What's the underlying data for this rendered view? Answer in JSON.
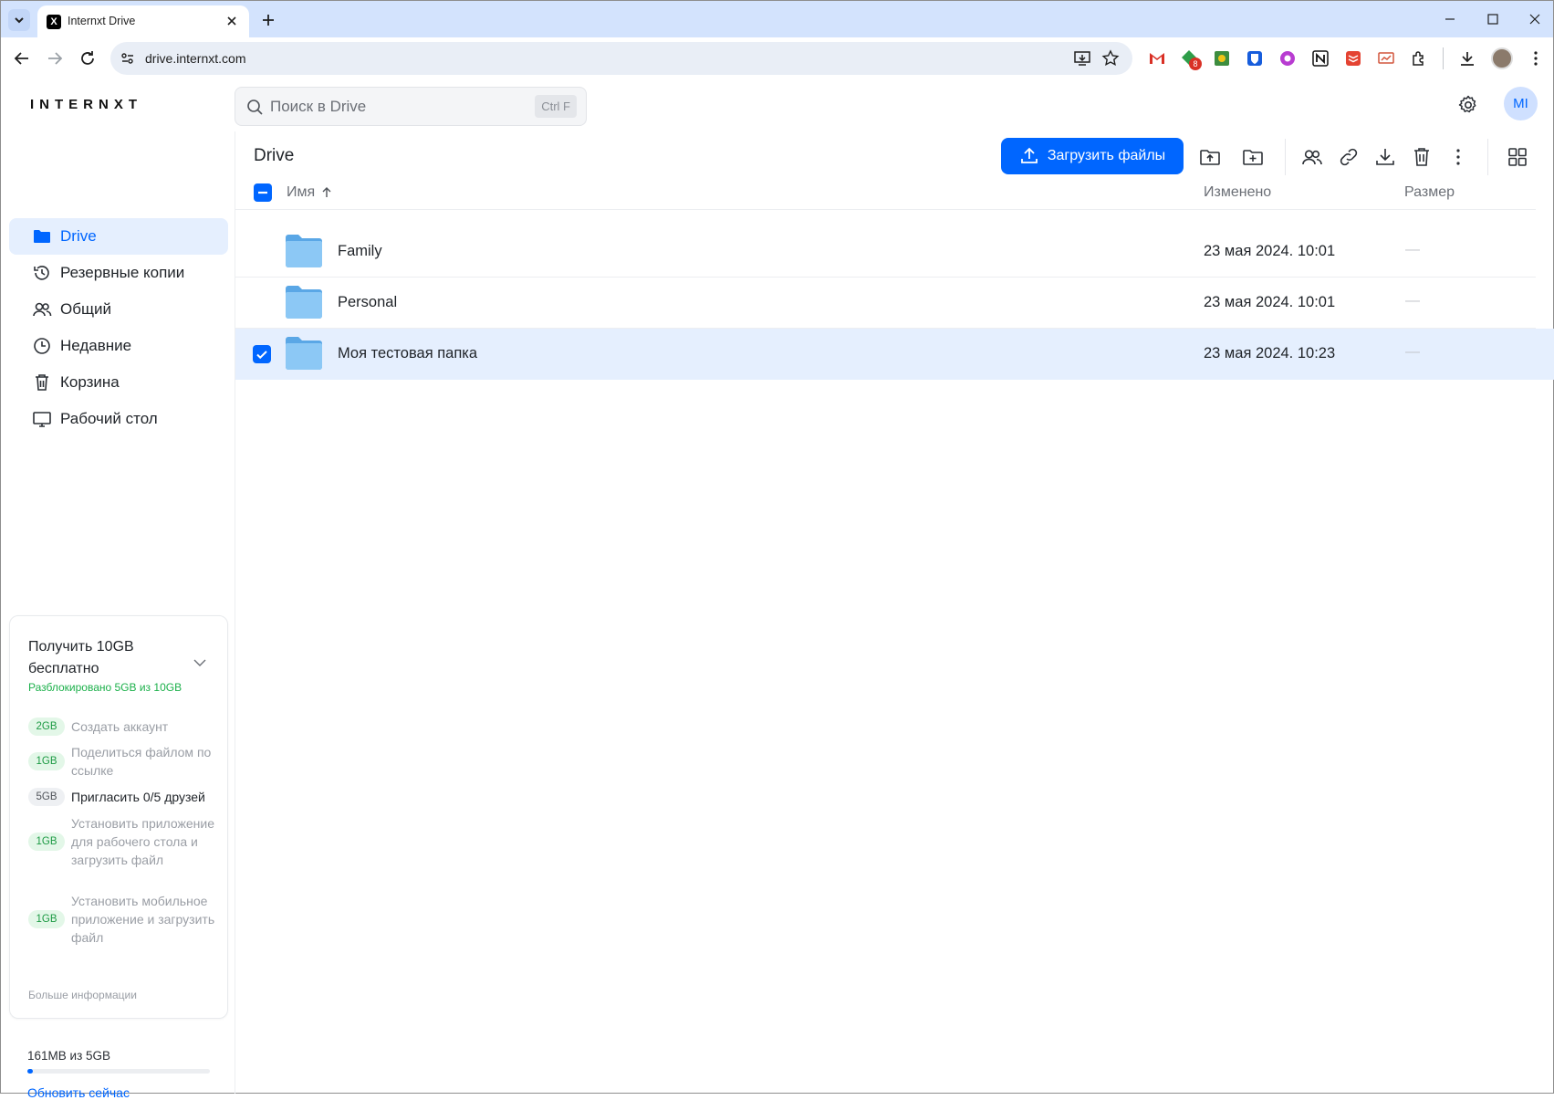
{
  "browser": {
    "tab_title": "Internxt Drive",
    "tab_favicon": "X",
    "url": "drive.internxt.com",
    "ext_badge": "8"
  },
  "app": {
    "logo": "INTERNXT",
    "search_placeholder": "Поиск в Drive",
    "search_shortcut": "Ctrl F",
    "avatar_initials": "MI",
    "accent_color": "#0066ff"
  },
  "sidebar": {
    "items": [
      {
        "label": "Drive",
        "icon": "folder-icon",
        "active": true
      },
      {
        "label": "Резервные копии",
        "icon": "history-icon"
      },
      {
        "label": "Общий",
        "icon": "users-icon"
      },
      {
        "label": "Недавние",
        "icon": "clock-icon"
      },
      {
        "label": "Корзина",
        "icon": "trash-icon"
      },
      {
        "label": "Рабочий стол",
        "icon": "desktop-icon"
      }
    ],
    "promo": {
      "title": "Получить 10GB бесплатно",
      "subtitle": "Разблокировано 5GB из 10GB",
      "tasks": [
        {
          "badge": "2GB",
          "text": "Создать аккаунт",
          "done": true
        },
        {
          "badge": "1GB",
          "text": "Поделиться файлом по ссылке",
          "done": true
        },
        {
          "badge": "5GB",
          "text": "Пригласить 0/5 друзей",
          "done": false
        },
        {
          "badge": "1GB",
          "text": "Установить приложение для рабочего стола и загрузить файл",
          "done": true
        },
        {
          "badge": "1GB",
          "text": "Установить мобильное приложение и загрузить файл",
          "done": true
        }
      ],
      "more": "Больше информации"
    },
    "usage": {
      "text": "161MB из 5GB",
      "fraction": 0.032,
      "upgrade": "Обновить сейчас"
    }
  },
  "main": {
    "title": "Drive",
    "upload_label": "Загрузить файлы",
    "columns": {
      "name": "Имя",
      "modified": "Изменено",
      "size": "Размер"
    },
    "rows": [
      {
        "name": "Family",
        "modified": "23 мая 2024. 10:01",
        "size": "—",
        "selected": false
      },
      {
        "name": "Personal",
        "modified": "23 мая 2024. 10:01",
        "size": "—",
        "selected": false
      },
      {
        "name": "Моя тестовая папка",
        "modified": "23 мая 2024. 10:23",
        "size": "—",
        "selected": true
      }
    ]
  }
}
